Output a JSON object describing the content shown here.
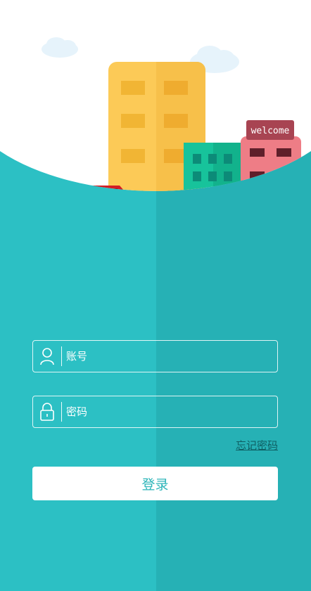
{
  "hero": {
    "sign_text": "welcome"
  },
  "form": {
    "account_placeholder": "账号",
    "password_placeholder": "密码",
    "forgot_label": "忘记密码",
    "login_label": "登录"
  },
  "icons": {
    "account": "user-icon",
    "password": "lock-icon"
  },
  "colors": {
    "background": "#2cc0c4",
    "background_shade": "#26b1b5",
    "button_text": "#2cb5b9",
    "link": "#0f5f63"
  }
}
